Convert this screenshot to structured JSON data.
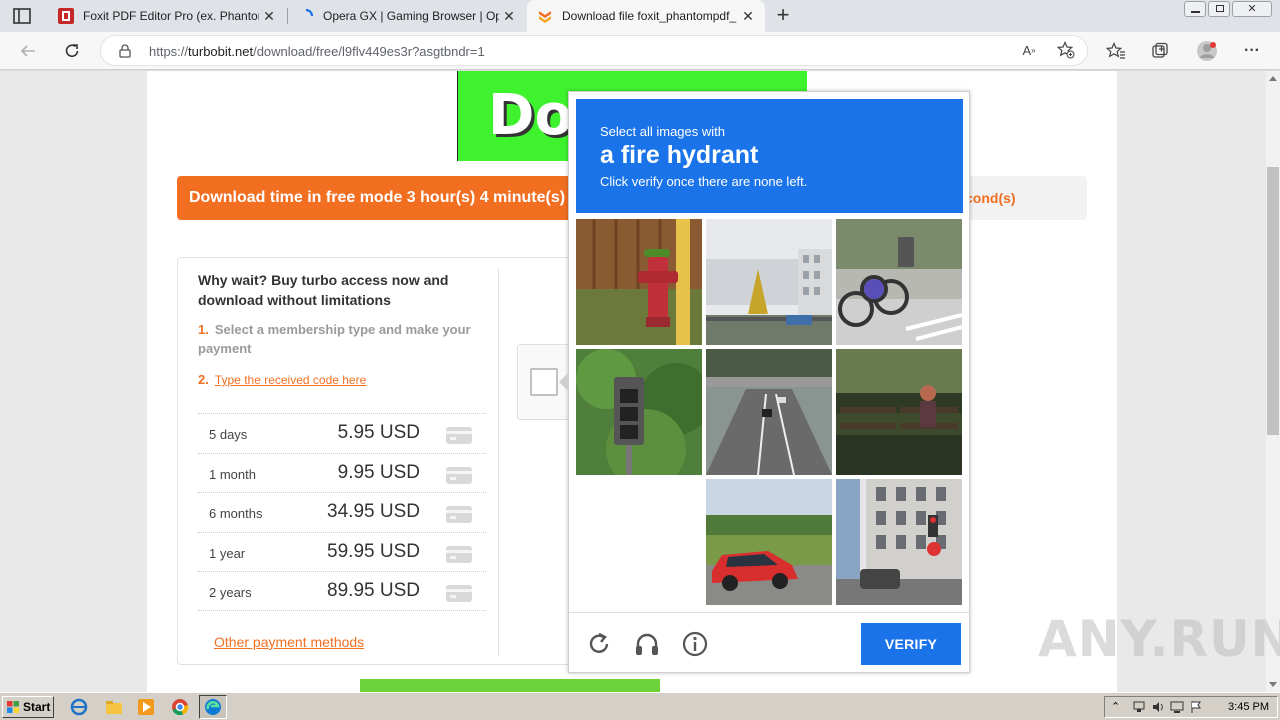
{
  "browser": {
    "tabs": [
      {
        "title": "Foxit PDF Editor Pro (ex. Phantom",
        "active": false
      },
      {
        "title": "Opera GX | Gaming Browser | Op",
        "active": false
      },
      {
        "title": "Download file foxit_phantompdf_",
        "active": true
      }
    ],
    "url_prefix": "https://",
    "url_domain": "turbobit.net",
    "url_path": "/download/free/l9flv449es3r?asgtbndr=1"
  },
  "page": {
    "banner_text": "Do",
    "time_notice": "Download time in free mode 3 hour(s) 4 minute(s)",
    "time_right": "cond(s)",
    "panel_heading": "Why wait? Buy turbo access now and download without limitations",
    "step1_num": "1.",
    "step1_text": "Select a membership type and make your payment",
    "step2_num": "2.",
    "step2_link": "Type the received code here",
    "prices": [
      {
        "duration": "5 days",
        "amount": "5.95 USD"
      },
      {
        "duration": "1 month",
        "amount": "9.95 USD"
      },
      {
        "duration": "6 months",
        "amount": "34.95 USD"
      },
      {
        "duration": "1 year",
        "amount": "59.95 USD"
      },
      {
        "duration": "2 years",
        "amount": "89.95 USD"
      }
    ],
    "other_payment": "Other payment methods"
  },
  "captcha": {
    "line1": "Select all images with",
    "target": "a fire hydrant",
    "line3": "Click verify once there are none left.",
    "verify_label": "VERIFY"
  },
  "watermark": "ANY.RUN",
  "taskbar": {
    "start_label": "Start",
    "clock": "3:45 PM"
  },
  "colors": {
    "accent_orange": "#f26f22",
    "captcha_blue": "#1a73e8",
    "banner_green": "#3ef22e"
  }
}
